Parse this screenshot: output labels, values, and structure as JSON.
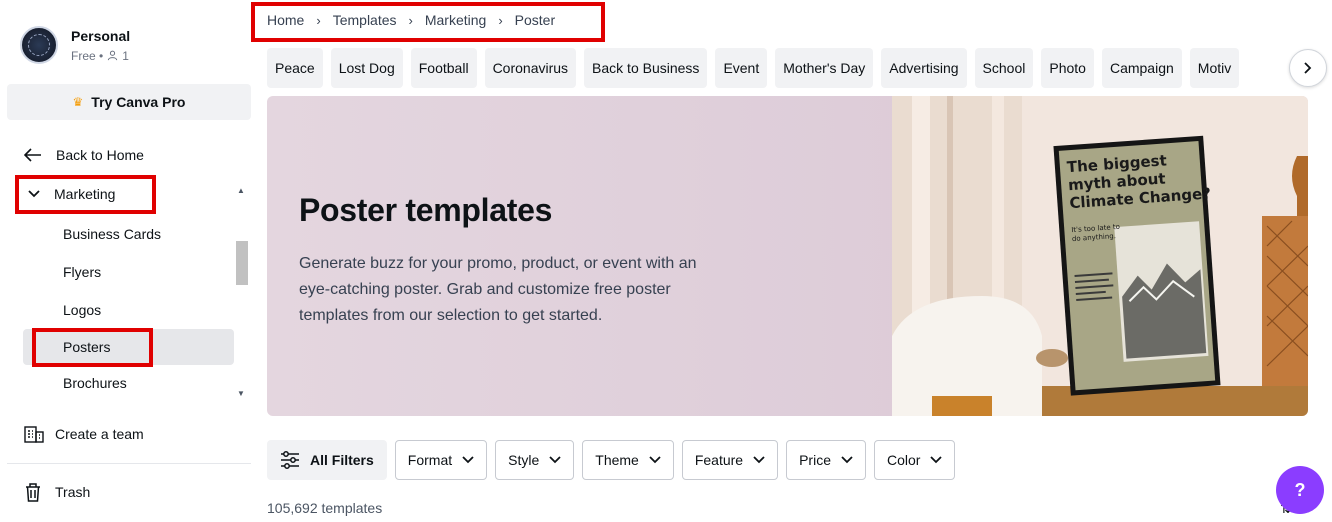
{
  "account": {
    "name": "Personal",
    "plan": "Free •",
    "members": "1"
  },
  "sidebar": {
    "pro_label": "Try Canva Pro",
    "back_label": "Back to Home",
    "category": "Marketing",
    "items": [
      {
        "label": "Business Cards"
      },
      {
        "label": "Flyers"
      },
      {
        "label": "Logos"
      },
      {
        "label": "Posters"
      },
      {
        "label": "Brochures"
      }
    ],
    "create_team": "Create a team",
    "trash": "Trash"
  },
  "breadcrumb": [
    "Home",
    "Templates",
    "Marketing",
    "Poster"
  ],
  "chips": [
    "Peace",
    "Lost Dog",
    "Football",
    "Coronavirus",
    "Back to Business",
    "Event",
    "Mother's Day",
    "Advertising",
    "School",
    "Photo",
    "Campaign",
    "Motiv"
  ],
  "hero": {
    "title": "Poster templates",
    "description": "Generate buzz for your promo, product, or event with an eye-catching poster. Grab and customize free poster templates from our selection to get started.",
    "poster_headline": "The biggest myth about Climate Change?",
    "poster_sub": "It's too late to do anything."
  },
  "filters": {
    "all": "All Filters",
    "items": [
      "Format",
      "Style",
      "Theme",
      "Feature",
      "Price",
      "Color"
    ]
  },
  "template_count": "105,692 templates",
  "help_label": "?",
  "colors": {
    "accent": "#8b3dff",
    "highlight": "#e00000",
    "hero_bg": "#e4d6df",
    "chip_bg": "#f1f2f4"
  }
}
